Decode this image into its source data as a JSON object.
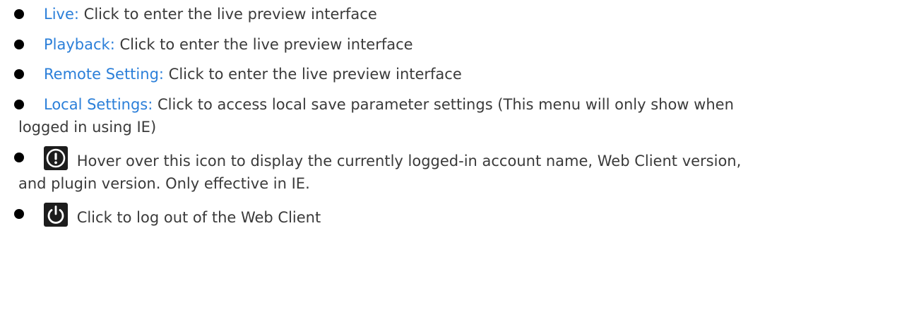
{
  "items": [
    {
      "term": "Live:",
      "desc": "Click to enter the live preview interface"
    },
    {
      "term": "Playback:",
      "desc": "Click to enter the live preview interface"
    },
    {
      "term": "Remote Setting:",
      "desc": "Click to enter the live preview interface"
    },
    {
      "term": "Local Settings:",
      "desc": "Click to access local save parameter settings (This menu will only show when",
      "desc_cont": "logged in using IE)"
    },
    {
      "icon": "info-exclamation-icon",
      "desc": "Hover over this icon to display the currently logged-in account name, Web Client version,",
      "desc_cont": "and plugin version. Only effective in IE."
    },
    {
      "icon": "power-icon",
      "desc": "Click to log out of the Web Client"
    }
  ],
  "colors": {
    "term": "#2b7fd9",
    "text": "#3a3a3a",
    "icon_bg": "#1d1d1d"
  }
}
